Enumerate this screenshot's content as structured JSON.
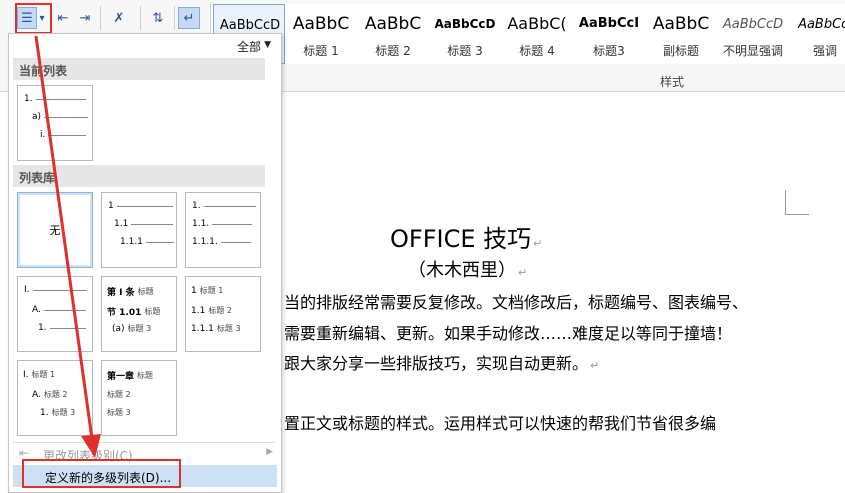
{
  "ribbon": {
    "tools": [
      {
        "name": "multilevel-list-icon",
        "glyph": "☰"
      },
      {
        "name": "dropdown-arrow-icon",
        "glyph": "▾"
      },
      {
        "name": "decrease-indent-icon",
        "glyph": "⇤"
      },
      {
        "name": "increase-indent-icon",
        "glyph": "⇥"
      },
      {
        "name": "chinese-layout-icon",
        "glyph": "✗"
      },
      {
        "name": "sort-icon",
        "glyph": "⇅"
      },
      {
        "name": "show-marks-icon",
        "glyph": "↵"
      }
    ],
    "styles": [
      {
        "sample": "AaBbCcD",
        "name": "",
        "size": 13
      },
      {
        "sample": "AaBbC",
        "name": "标题 1",
        "size": 17
      },
      {
        "sample": "AaBbC",
        "name": "标题 2",
        "size": 17
      },
      {
        "sample": "AaBbCcD",
        "name": "标题 3",
        "size": 12
      },
      {
        "sample": "AaBbC(",
        "name": "标题 4",
        "size": 16
      },
      {
        "sample": "AaBbCcI",
        "name": "标题3",
        "size": 13
      },
      {
        "sample": "AaBbC",
        "name": "副标题",
        "size": 17
      },
      {
        "sample": "AaBbCcD",
        "name": "不明显强调",
        "size": 13
      },
      {
        "sample": "AaBbCcl",
        "name": "强调",
        "size": 13
      }
    ],
    "group_label": "样式"
  },
  "panel": {
    "filter": "全部",
    "section_current": "当前列表",
    "section_library": "列表库",
    "none_label": "无",
    "current_thumb": {
      "lines": [
        "1.",
        "a)",
        "i."
      ]
    },
    "library": [
      {
        "lines": [
          "1",
          "1.1",
          "1.1.1"
        ]
      },
      {
        "lines": [
          "1.",
          "1.1.",
          "1.1.1."
        ]
      },
      {
        "lines": [
          "I.",
          "A.",
          "1."
        ]
      },
      {
        "lines": [
          "第 I 条",
          "节 1.01",
          "(a)"
        ],
        "tags": [
          "标题",
          "标题",
          "标题 3"
        ]
      },
      {
        "lines": [
          "1",
          "1.1",
          "1.1.1"
        ],
        "tags": [
          "标题 1",
          "标题 2",
          "标题 3"
        ]
      },
      {
        "lines": [
          "I.",
          "A.",
          "1."
        ],
        "tags": [
          "标题 1",
          "标题 2",
          "标题 3"
        ]
      },
      {
        "lines": [
          "第一章"
        ],
        "tags": [
          "标题",
          "标题 2",
          "标题 3"
        ]
      }
    ],
    "change_level": "更改列表级别(C)",
    "define_new": "定义新的多级列表(D)..."
  },
  "document": {
    "title": "OFFICE 技巧",
    "subtitle": "（木木西里）",
    "lines": [
      "当的排版经常需要反复修改。文档修改后，标题编号、图表编号、",
      "需要重新编辑、更新。如果手动修改……难度足以等同于撞墙！",
      "跟大家分享一些排版技巧，实现自动更新。",
      "",
      "置正文或标题的样式。运用样式可以快速的帮我们节省很多编"
    ]
  },
  "colors": {
    "annotation_red": "#e0302a",
    "selection_blue": "#cde0f5"
  }
}
